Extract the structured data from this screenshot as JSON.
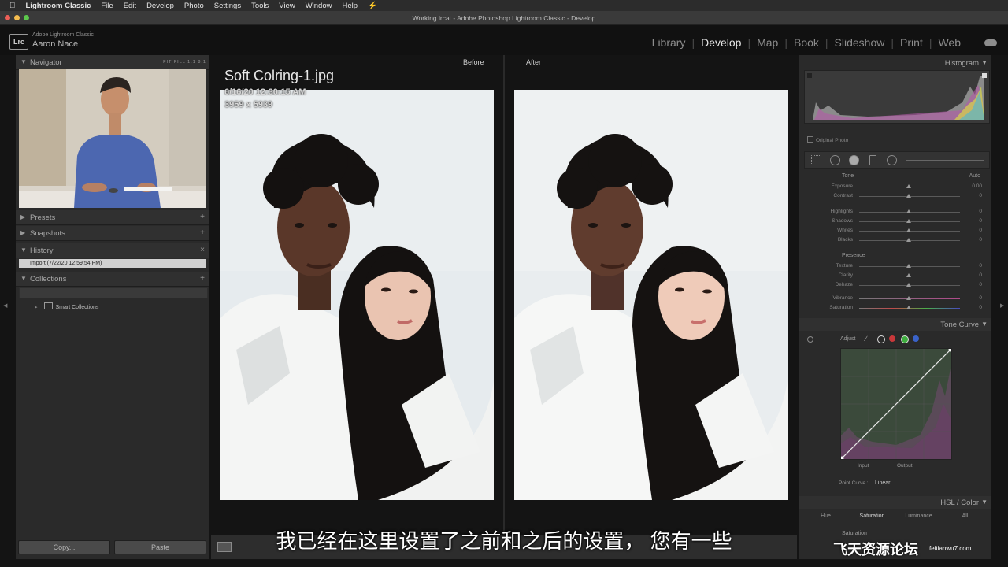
{
  "menubar": {
    "app": "Lightroom Classic",
    "items": [
      "File",
      "Edit",
      "Develop",
      "Photo",
      "Settings",
      "Tools",
      "View",
      "Window",
      "Help"
    ]
  },
  "window": {
    "title": "Working.lrcat - Adobe Photoshop Lightroom Classic - Develop"
  },
  "identity": {
    "logo": "Lrc",
    "app_name": "Adobe Lightroom Classic",
    "user": "Aaron Nace"
  },
  "modules": {
    "items": [
      "Library",
      "Develop",
      "Map",
      "Book",
      "Slideshow",
      "Print",
      "Web"
    ],
    "active": "Develop"
  },
  "left_panel": {
    "navigator": {
      "label": "Navigator",
      "options": [
        "FIT",
        "FILL",
        "1:1",
        "8:1"
      ]
    },
    "presets": {
      "label": "Presets"
    },
    "snapshots": {
      "label": "Snapshots"
    },
    "history": {
      "label": "History",
      "items": [
        "Import (7/22/20 12:59:54 PM)"
      ]
    },
    "collections": {
      "label": "Collections",
      "smart_collections": "Smart Collections"
    },
    "copy_label": "Copy...",
    "paste_label": "Paste"
  },
  "center": {
    "before_label": "Before",
    "after_label": "After",
    "file_name": "Soft Colring-1.jpg",
    "date": "6/16/20 12:30:15 AM",
    "dimensions": "3959 x 5939",
    "subtitle": "我已经在这里设置了之前和之后的设置， 您有一些"
  },
  "right_panel": {
    "histogram_label": "Histogram",
    "original_photo": "Original Photo",
    "tone_label": "Tone",
    "auto_label": "Auto",
    "tone_sliders": [
      {
        "name": "Exposure",
        "value": "0.00"
      },
      {
        "name": "Contrast",
        "value": "0"
      },
      {
        "name": "Highlights",
        "value": "0"
      },
      {
        "name": "Shadows",
        "value": "0"
      },
      {
        "name": "Whites",
        "value": "0"
      },
      {
        "name": "Blacks",
        "value": "0"
      }
    ],
    "presence_label": "Presence",
    "presence_sliders": [
      {
        "name": "Texture",
        "value": "0"
      },
      {
        "name": "Clarity",
        "value": "0"
      },
      {
        "name": "Dehaze",
        "value": "0"
      },
      {
        "name": "Vibrance",
        "value": "0"
      },
      {
        "name": "Saturation",
        "value": "0"
      }
    ],
    "tone_curve_label": "Tone Curve",
    "adjust_label": "Adjust",
    "input_label": "Input",
    "output_label": "Output",
    "point_curve_label": "Point Curve :",
    "point_curve_value": "Linear",
    "hsl_label": "HSL / Color",
    "hsl_tabs": [
      "Hue",
      "Saturation",
      "Luminance",
      "All"
    ],
    "hsl_active": "Saturation",
    "hsl_sub": "Saturation"
  },
  "watermark": {
    "text": "飞天资源论坛",
    "url": "feitianwu7.com"
  },
  "colors": {
    "bg": "#141414",
    "panel": "#2a2a2a",
    "accent": "#e8e8e8"
  }
}
